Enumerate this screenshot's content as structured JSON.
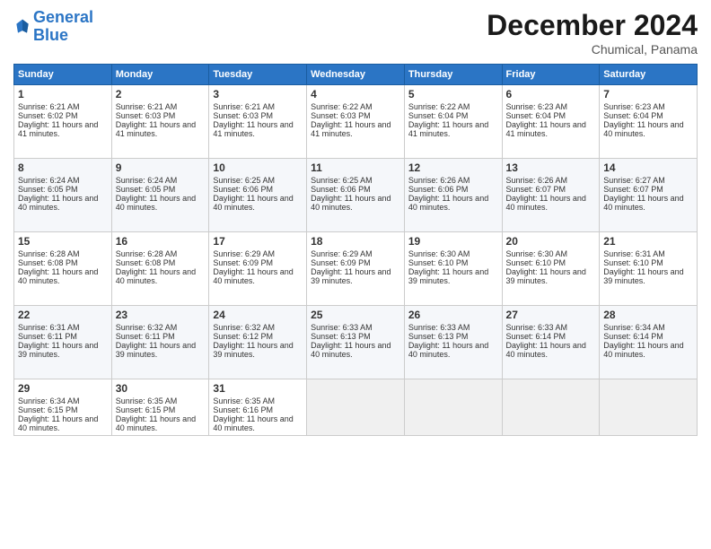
{
  "header": {
    "logo_line1": "General",
    "logo_line2": "Blue",
    "month": "December 2024",
    "location": "Chumical, Panama"
  },
  "weekdays": [
    "Sunday",
    "Monday",
    "Tuesday",
    "Wednesday",
    "Thursday",
    "Friday",
    "Saturday"
  ],
  "weeks": [
    [
      {
        "day": "1",
        "sunrise": "6:21 AM",
        "sunset": "6:02 PM",
        "daylight": "11 hours and 41 minutes"
      },
      {
        "day": "2",
        "sunrise": "6:21 AM",
        "sunset": "6:03 PM",
        "daylight": "11 hours and 41 minutes"
      },
      {
        "day": "3",
        "sunrise": "6:21 AM",
        "sunset": "6:03 PM",
        "daylight": "11 hours and 41 minutes"
      },
      {
        "day": "4",
        "sunrise": "6:22 AM",
        "sunset": "6:03 PM",
        "daylight": "11 hours and 41 minutes"
      },
      {
        "day": "5",
        "sunrise": "6:22 AM",
        "sunset": "6:04 PM",
        "daylight": "11 hours and 41 minutes"
      },
      {
        "day": "6",
        "sunrise": "6:23 AM",
        "sunset": "6:04 PM",
        "daylight": "11 hours and 41 minutes"
      },
      {
        "day": "7",
        "sunrise": "6:23 AM",
        "sunset": "6:04 PM",
        "daylight": "11 hours and 40 minutes"
      }
    ],
    [
      {
        "day": "8",
        "sunrise": "6:24 AM",
        "sunset": "6:05 PM",
        "daylight": "11 hours and 40 minutes"
      },
      {
        "day": "9",
        "sunrise": "6:24 AM",
        "sunset": "6:05 PM",
        "daylight": "11 hours and 40 minutes"
      },
      {
        "day": "10",
        "sunrise": "6:25 AM",
        "sunset": "6:06 PM",
        "daylight": "11 hours and 40 minutes"
      },
      {
        "day": "11",
        "sunrise": "6:25 AM",
        "sunset": "6:06 PM",
        "daylight": "11 hours and 40 minutes"
      },
      {
        "day": "12",
        "sunrise": "6:26 AM",
        "sunset": "6:06 PM",
        "daylight": "11 hours and 40 minutes"
      },
      {
        "day": "13",
        "sunrise": "6:26 AM",
        "sunset": "6:07 PM",
        "daylight": "11 hours and 40 minutes"
      },
      {
        "day": "14",
        "sunrise": "6:27 AM",
        "sunset": "6:07 PM",
        "daylight": "11 hours and 40 minutes"
      }
    ],
    [
      {
        "day": "15",
        "sunrise": "6:28 AM",
        "sunset": "6:08 PM",
        "daylight": "11 hours and 40 minutes"
      },
      {
        "day": "16",
        "sunrise": "6:28 AM",
        "sunset": "6:08 PM",
        "daylight": "11 hours and 40 minutes"
      },
      {
        "day": "17",
        "sunrise": "6:29 AM",
        "sunset": "6:09 PM",
        "daylight": "11 hours and 40 minutes"
      },
      {
        "day": "18",
        "sunrise": "6:29 AM",
        "sunset": "6:09 PM",
        "daylight": "11 hours and 39 minutes"
      },
      {
        "day": "19",
        "sunrise": "6:30 AM",
        "sunset": "6:10 PM",
        "daylight": "11 hours and 39 minutes"
      },
      {
        "day": "20",
        "sunrise": "6:30 AM",
        "sunset": "6:10 PM",
        "daylight": "11 hours and 39 minutes"
      },
      {
        "day": "21",
        "sunrise": "6:31 AM",
        "sunset": "6:10 PM",
        "daylight": "11 hours and 39 minutes"
      }
    ],
    [
      {
        "day": "22",
        "sunrise": "6:31 AM",
        "sunset": "6:11 PM",
        "daylight": "11 hours and 39 minutes"
      },
      {
        "day": "23",
        "sunrise": "6:32 AM",
        "sunset": "6:11 PM",
        "daylight": "11 hours and 39 minutes"
      },
      {
        "day": "24",
        "sunrise": "6:32 AM",
        "sunset": "6:12 PM",
        "daylight": "11 hours and 39 minutes"
      },
      {
        "day": "25",
        "sunrise": "6:33 AM",
        "sunset": "6:13 PM",
        "daylight": "11 hours and 40 minutes"
      },
      {
        "day": "26",
        "sunrise": "6:33 AM",
        "sunset": "6:13 PM",
        "daylight": "11 hours and 40 minutes"
      },
      {
        "day": "27",
        "sunrise": "6:33 AM",
        "sunset": "6:14 PM",
        "daylight": "11 hours and 40 minutes"
      },
      {
        "day": "28",
        "sunrise": "6:34 AM",
        "sunset": "6:14 PM",
        "daylight": "11 hours and 40 minutes"
      }
    ],
    [
      {
        "day": "29",
        "sunrise": "6:34 AM",
        "sunset": "6:15 PM",
        "daylight": "11 hours and 40 minutes"
      },
      {
        "day": "30",
        "sunrise": "6:35 AM",
        "sunset": "6:15 PM",
        "daylight": "11 hours and 40 minutes"
      },
      {
        "day": "31",
        "sunrise": "6:35 AM",
        "sunset": "6:16 PM",
        "daylight": "11 hours and 40 minutes"
      },
      null,
      null,
      null,
      null
    ]
  ]
}
